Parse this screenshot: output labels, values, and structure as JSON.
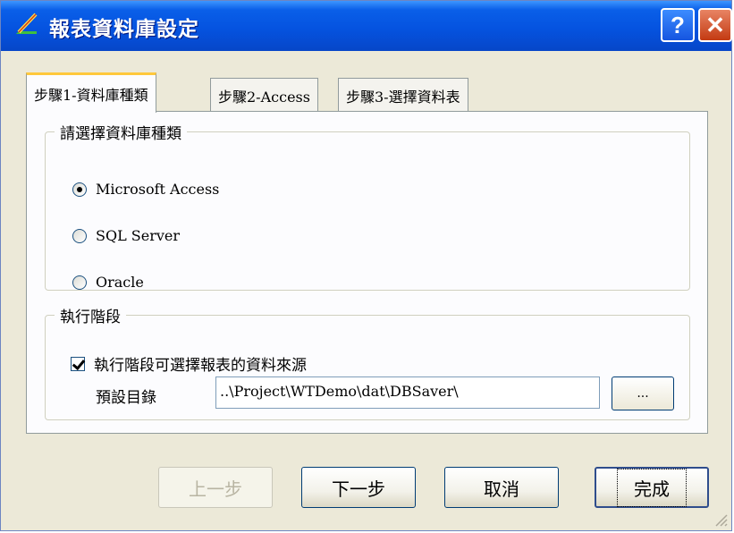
{
  "window": {
    "title": "報表資料庫設定",
    "help_label": "?",
    "close_label": "✕"
  },
  "tabs": [
    {
      "label": "步驟1-資料庫種類",
      "active": true
    },
    {
      "label": "步驟2-Access",
      "active": false
    },
    {
      "label": "步驟3-選擇資料表",
      "active": false
    }
  ],
  "db_group": {
    "legend": "請選擇資料庫種類",
    "options": [
      {
        "label": "Microsoft Access",
        "selected": true
      },
      {
        "label": "SQL Server",
        "selected": false
      },
      {
        "label": "Oracle",
        "selected": false
      }
    ]
  },
  "runtime_group": {
    "legend": "執行階段",
    "checkbox_label": "執行階段可選擇報表的資料來源",
    "checkbox_checked": true,
    "dir_label": "預設目錄",
    "dir_value": "..\\Project\\WTDemo\\dat\\DBSaver\\",
    "browse_label": "..."
  },
  "buttons": {
    "prev": "上一步",
    "next": "下一步",
    "cancel": "取消",
    "finish": "完成"
  },
  "colors": {
    "titlebar": "#0553e0",
    "dialog_bg": "#ece9d8",
    "tab_highlight": "#ffc83c"
  },
  "icons": {
    "title": "report-pen-icon",
    "help": "help-icon",
    "close": "close-icon",
    "grip": "resize-grip-icon"
  }
}
